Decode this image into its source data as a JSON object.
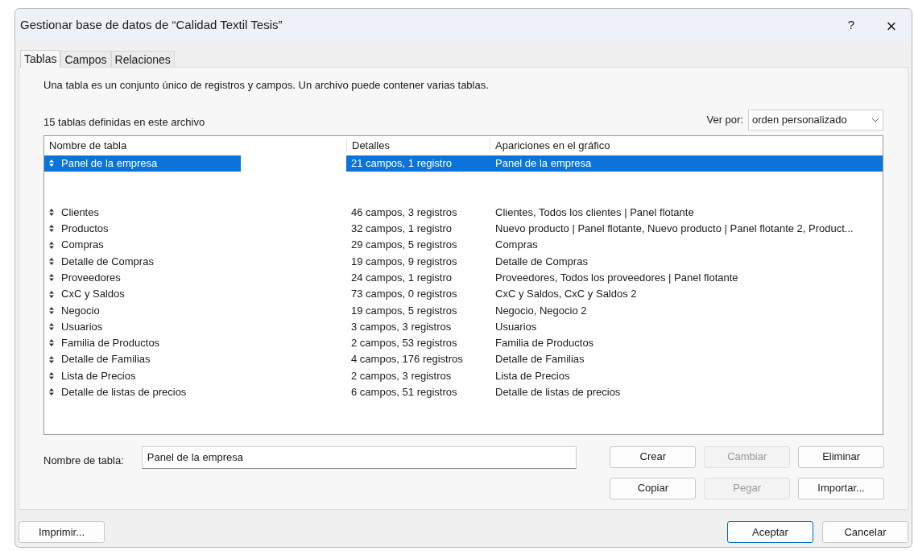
{
  "window": {
    "title": "Gestionar base de datos de “Calidad Textil Tesis”",
    "help": "?",
    "close": "×"
  },
  "tabs": [
    {
      "label": "Tablas",
      "selected": true
    },
    {
      "label": "Campos",
      "selected": false
    },
    {
      "label": "Relaciones",
      "selected": false
    }
  ],
  "description": "Una tabla es un conjunto único de registros y campos. Un archivo puede contener varias tablas.",
  "count": "15 tablas definidas en este archivo",
  "view_by": {
    "label": "Ver por:",
    "value": "orden personalizado"
  },
  "table": {
    "columns": [
      "Nombre de tabla",
      "Detalles",
      "Apariciones en el gráfico"
    ],
    "rows": [
      {
        "kind": "table",
        "name": "Panel de la empresa",
        "details": "21 campos, 1 registro",
        "appearances": "Panel de la empresa",
        "selected": true
      },
      {
        "kind": "blank"
      },
      {
        "kind": "blank"
      },
      {
        "kind": "table",
        "name": "Clientes",
        "details": "46 campos, 3 registros",
        "appearances": "Clientes, Todos los clientes | Panel flotante",
        "selected": false
      },
      {
        "kind": "table",
        "name": "Productos",
        "details": "32 campos, 1 registro",
        "appearances": "Nuevo producto | Panel flotante, Nuevo producto | Panel flotante 2, Product...",
        "selected": false
      },
      {
        "kind": "table",
        "name": "Compras",
        "details": "29 campos, 5 registros",
        "appearances": "Compras",
        "selected": false
      },
      {
        "kind": "table",
        "name": "Detalle de Compras",
        "details": "19 campos, 9 registros",
        "appearances": "Detalle de Compras",
        "selected": false
      },
      {
        "kind": "table",
        "name": "Proveedores",
        "details": "24 campos, 1 registro",
        "appearances": "Proveedores, Todos los proveedores | Panel flotante",
        "selected": false
      },
      {
        "kind": "table",
        "name": "CxC y Saldos",
        "details": "73 campos, 0 registros",
        "appearances": "CxC y Saldos, CxC y Saldos 2",
        "selected": false
      },
      {
        "kind": "table",
        "name": "Negocio",
        "details": "19 campos, 5 registros",
        "appearances": "Negocio, Negocio 2",
        "selected": false
      },
      {
        "kind": "table",
        "name": "Usuarios",
        "details": "3 campos, 3 registros",
        "appearances": "Usuarios",
        "selected": false
      },
      {
        "kind": "table",
        "name": "Familia de Productos",
        "details": "2 campos, 53 registros",
        "appearances": "Familia de Productos",
        "selected": false
      },
      {
        "kind": "table",
        "name": "Detalle de Familias",
        "details": "4 campos, 176 registros",
        "appearances": "Detalle de Familias",
        "selected": false
      },
      {
        "kind": "table",
        "name": "Lista de Precios",
        "details": "2 campos, 3 registros",
        "appearances": "Lista de Precios",
        "selected": false
      },
      {
        "kind": "table",
        "name": "Detalle de listas de precios",
        "details": "6 campos, 51 registros",
        "appearances": "Detalle de listas de precios",
        "selected": false
      }
    ]
  },
  "name_field": {
    "label": "Nombre de tabla:",
    "value": "Panel de la empresa"
  },
  "actions": [
    {
      "label": "Crear",
      "disabled": false
    },
    {
      "label": "Cambiar",
      "disabled": true
    },
    {
      "label": "Eliminar",
      "disabled": false
    },
    {
      "label": "Copiar",
      "disabled": false
    },
    {
      "label": "Pegar",
      "disabled": true
    },
    {
      "label": "Importar...",
      "disabled": false
    }
  ],
  "footer": {
    "print": "Imprimir...",
    "ok": "Aceptar",
    "cancel": "Cancelar"
  }
}
